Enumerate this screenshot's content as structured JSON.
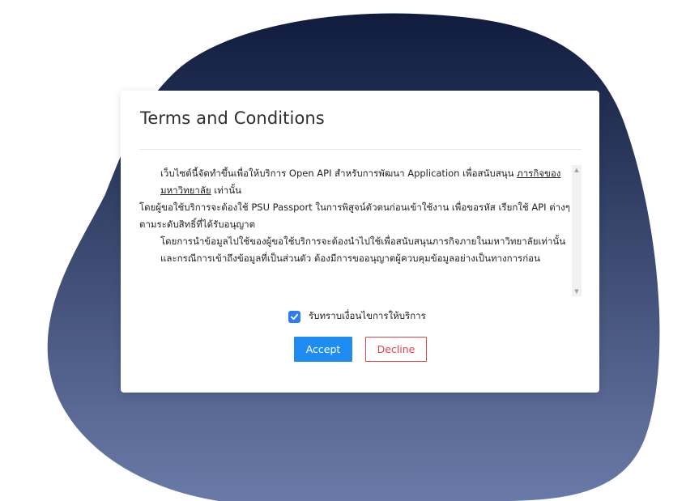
{
  "colors": {
    "blob_top": "#101c3d",
    "blob_bottom": "#6a7aa8",
    "primary": "#1e8cf0",
    "danger": "#e0424b",
    "checkbox": "#2f7bf2"
  },
  "dialog": {
    "title": "Terms and Conditions",
    "terms": {
      "p1_text": "เว็บไซต์นี้จัดทำขึ้นเพื่อให้บริการ Open API สำหรับการพัฒนา Application เพื่อสนับสนุน ",
      "p1_link": "ภารกิจของมหาวิทยาลัย",
      "p1_suffix": " เท่านั้น",
      "p2": "โดยผู้ขอใช้บริการจะต้องใช้ PSU Passport ในการพิสูจน์ตัวตนก่อนเข้าใช้งาน เพื่อขอรหัส เรียกใช้ API ต่างๆ ตามระดับสิทธิ์ที่ได้รับอนุญาต",
      "p3": "โดยการนำข้อมูลไปใช้ของผู้ขอใช้บริการจะต้องนำไปใช้เพื่อสนับสนุนภารกิจภายในมหาวิทยาลัยเท่านั้น และกรณีการเข้าถึงข้อมูลที่เป็นส่วนตัว ต้องมีการขออนุญาตผู้ควบคุมข้อมูลอย่างเป็นทางการก่อน"
    },
    "accept_checkbox": {
      "label": "รับทราบเงื่อนไขการให้บริการ",
      "checked": true
    },
    "buttons": {
      "accept": "Accept",
      "decline": "Decline"
    }
  }
}
